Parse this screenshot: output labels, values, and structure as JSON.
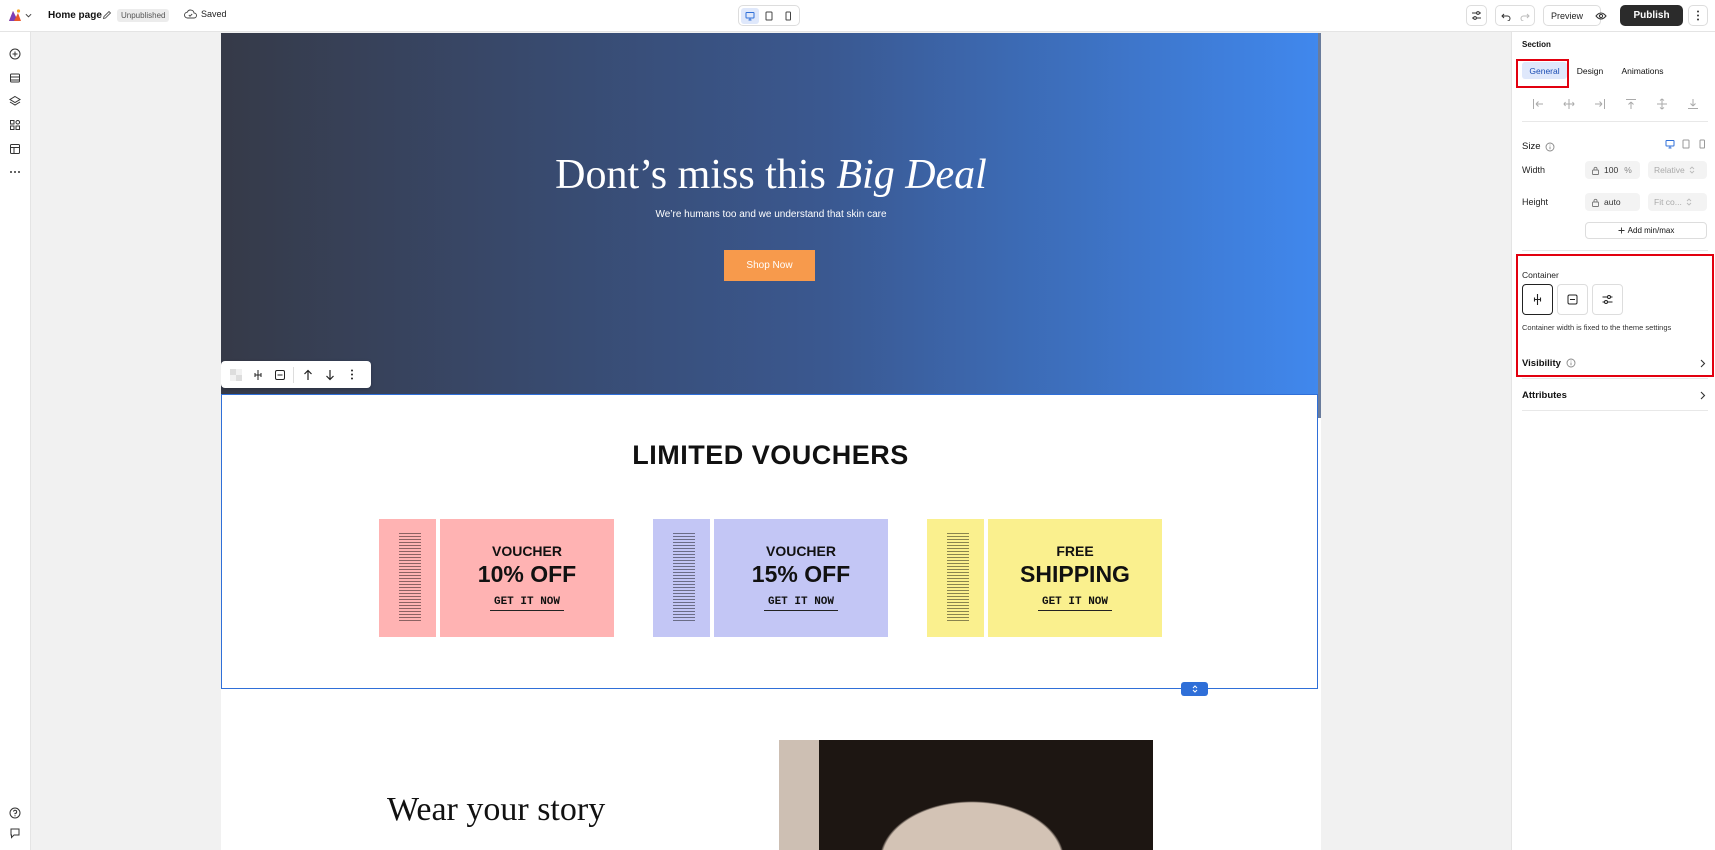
{
  "topbar": {
    "page_name": "Home page",
    "status_badge": "Unpublished",
    "save_status": "Saved",
    "preview_label": "Preview",
    "publish_label": "Publish"
  },
  "canvas": {
    "hero": {
      "title_plain": "Dont’s miss this ",
      "title_italic": "Big Deal",
      "subtitle": "We’re humans too and we understand that skin care",
      "button_label": "Shop Now"
    },
    "vouchers": {
      "title": "LIMITED VOUCHERS",
      "items": [
        {
          "line1": "VOUCHER",
          "line2": "10% OFF",
          "cta": "GET IT NOW",
          "color": "#ffb3b3"
        },
        {
          "line1": "VOUCHER",
          "line2": "15% OFF",
          "cta": "GET IT NOW",
          "color": "#c3c6f5"
        },
        {
          "line1": "FREE",
          "line2": "SHIPPING",
          "cta": "GET IT NOW",
          "color": "#faf08e"
        }
      ]
    },
    "story": {
      "heading": "Wear your story"
    }
  },
  "panel": {
    "section_label": "Section",
    "tabs": [
      "General",
      "Design",
      "Animations"
    ],
    "active_tab": "General",
    "size": {
      "label": "Size",
      "width_label": "Width",
      "width_value": "100",
      "width_unit": "%",
      "width_mode": "Relative",
      "height_label": "Height",
      "height_value": "auto",
      "height_mode": "Fit co...",
      "add_minmax": "Add min/max"
    },
    "container": {
      "label": "Container",
      "note": "Container width is fixed to the theme settings"
    },
    "visibility_label": "Visibility",
    "attributes_label": "Attributes"
  },
  "colors": {
    "accent": "#2f6fd8",
    "highlight": "#e2000f",
    "shop_button": "#f79a4c",
    "publish": "#2b2b2b"
  }
}
